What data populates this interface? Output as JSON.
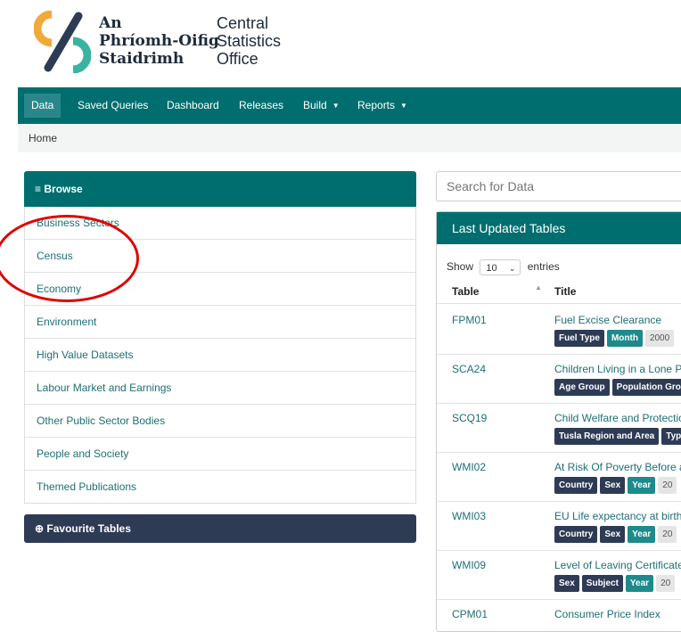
{
  "brand": {
    "irish_lines": [
      "An",
      "Phríomh-Oifig",
      "Staidrimh"
    ],
    "english_lines": [
      "Central",
      "Statistics",
      "Office"
    ],
    "colors": {
      "teal": "#006e6f",
      "navy": "#2e3b55",
      "orange": "#f2a93b",
      "green": "#3ab3a1"
    }
  },
  "nav": {
    "items": [
      {
        "label": "Data",
        "active": true
      },
      {
        "label": "Saved Queries"
      },
      {
        "label": "Dashboard"
      },
      {
        "label": "Releases"
      },
      {
        "label": "Build",
        "dropdown": true
      },
      {
        "label": "Reports",
        "dropdown": true
      }
    ],
    "caret": "▼"
  },
  "breadcrumb": {
    "home": "Home"
  },
  "browse": {
    "header_icon": "≡",
    "header_label": "Browse",
    "items": [
      "Business Sectors",
      "Census",
      "Economy",
      "Environment",
      "High Value Datasets",
      "Labour Market and Earnings",
      "Other Public Sector Bodies",
      "People and Society",
      "Themed Publications"
    ]
  },
  "favourites": {
    "icon": "⊕",
    "label": "Favourite Tables"
  },
  "search": {
    "placeholder": "Search for Data"
  },
  "last_updated": {
    "header": "Last Updated Tables",
    "show_label": "Show",
    "entries_label": "entries",
    "page_size": "10",
    "columns": {
      "table": "Table",
      "title": "Title"
    },
    "rows": [
      {
        "code": "FPM01",
        "title": "Fuel Excise Clearance",
        "tags": [
          "Fuel Type"
        ],
        "time_tag": "Month",
        "year": "2000"
      },
      {
        "code": "SCA24",
        "title": "Children Living in a Lone Pa",
        "tags": [
          "Age Group",
          "Population Gro"
        ],
        "time_tag": "",
        "year": ""
      },
      {
        "code": "SCQ19",
        "title": "Child Welfare and Protectio",
        "tags": [
          "Tusla Region and Area",
          "Typ"
        ],
        "time_tag": "",
        "year": ""
      },
      {
        "code": "WMI02",
        "title": "At Risk Of Poverty Before a",
        "tags": [
          "Country",
          "Sex"
        ],
        "time_tag": "Year",
        "year": "20"
      },
      {
        "code": "WMI03",
        "title": "EU Life expectancy at birth",
        "tags": [
          "Country",
          "Sex"
        ],
        "time_tag": "Year",
        "year": "20"
      },
      {
        "code": "WMI09",
        "title": "Level of Leaving Certificate",
        "tags": [
          "Sex",
          "Subject"
        ],
        "time_tag": "Year",
        "year": "20"
      },
      {
        "code": "CPM01",
        "title": "Consumer Price Index",
        "tags": [],
        "time_tag": "",
        "year": ""
      }
    ]
  }
}
